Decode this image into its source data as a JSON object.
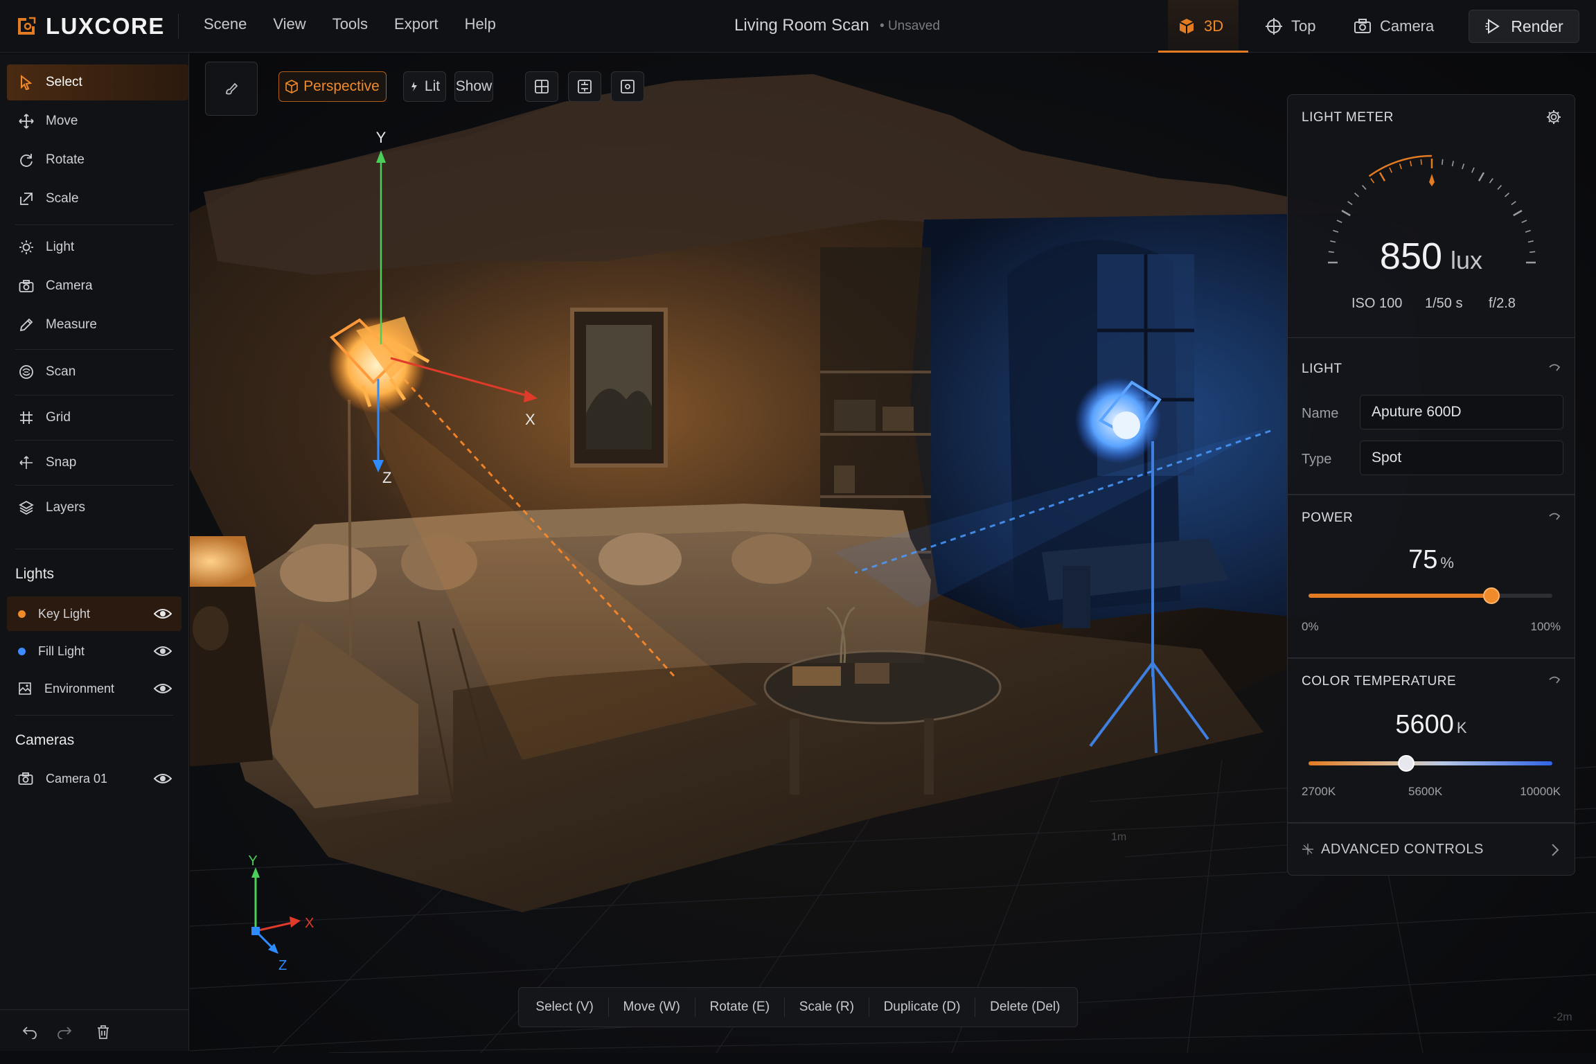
{
  "app": {
    "name": "LUXCORE"
  },
  "menu": [
    "Scene",
    "View",
    "Tools",
    "Export",
    "Help"
  ],
  "document": {
    "title": "Living Room Scan",
    "status": "Unsaved"
  },
  "view_tabs": {
    "threed": "3D",
    "top": "Top",
    "camera": "Camera",
    "render": "Render"
  },
  "tools": {
    "select": "Select",
    "move": "Move",
    "rotate": "Rotate",
    "scale": "Scale",
    "light": "Light",
    "camera": "Camera",
    "measure": "Measure",
    "scan": "Scan",
    "grid": "Grid",
    "snap": "Snap",
    "layers": "Layers"
  },
  "lights_section": {
    "title": "Lights",
    "items": [
      {
        "label": "Key Light",
        "color": "#f08a2a"
      },
      {
        "label": "Fill Light",
        "color": "#3d8bff"
      },
      {
        "label": "Environment"
      }
    ]
  },
  "cameras_section": {
    "title": "Cameras",
    "items": [
      {
        "label": "Camera 01"
      }
    ]
  },
  "viewport_toolbar": {
    "perspective": "Perspective",
    "lit": "Lit",
    "show": "Show"
  },
  "scene": {
    "key_axes": {
      "y": "Y",
      "x": "X",
      "z": "Z"
    },
    "gizmo": {
      "y": "Y",
      "x": "X",
      "z": "Z"
    },
    "scale_marks": {
      "m1": "1m",
      "m2": "-2m"
    }
  },
  "light_meter": {
    "title": "LIGHT METER",
    "value": "850",
    "unit": "lux",
    "iso": "ISO 100",
    "shutter": "1/50 s",
    "aperture": "f/2.8"
  },
  "light": {
    "title": "LIGHT",
    "name_label": "Name",
    "name_value": "Aputure 600D",
    "type_label": "Type",
    "type_value": "Spot"
  },
  "power": {
    "title": "POWER",
    "value": "75",
    "unit": "%",
    "fraction": 0.75,
    "min": "0%",
    "max": "100%"
  },
  "color_temperature": {
    "title": "COLOR TEMPERATURE",
    "value": "5600",
    "unit": "K",
    "fraction": 0.4,
    "min": "2700K",
    "mid": "5600K",
    "max": "10000K"
  },
  "advanced": {
    "label": "ADVANCED CONTROLS"
  },
  "shortcuts": [
    "Select (V)",
    "Move (W)",
    "Rotate (E)",
    "Scale (R)",
    "Duplicate (D)",
    "Delete (Del)"
  ],
  "colors": {
    "accent": "#e27b22",
    "fill": "#3d8bff"
  }
}
